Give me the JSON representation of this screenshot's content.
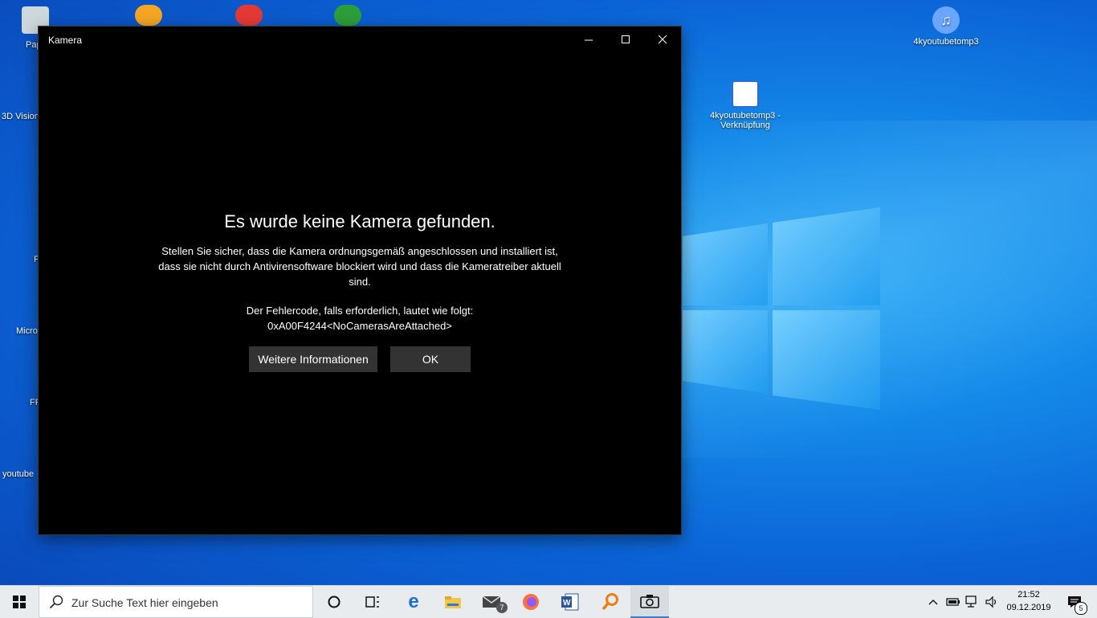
{
  "window": {
    "title": "Kamera",
    "headline": "Es wurde keine Kamera gefunden.",
    "body": "Stellen Sie sicher, dass die Kamera ordnungsgemäß angeschlossen und installiert ist, dass sie nicht durch Antivirensoftware blockiert wird und dass die Kameratreiber aktuell sind.",
    "code_line1": "Der Fehlercode, falls erforderlich, lautet wie folgt:",
    "code_line2": "0xA00F4244<NoCamerasAreAttached>",
    "more_button": "Weitere Informationen",
    "ok_button": "OK"
  },
  "desktop": {
    "left_labels": [
      "Pap",
      "3D Vision",
      "F",
      "Micro",
      "FR",
      "youtube"
    ],
    "icons": [
      {
        "label": "4kyoutubetomp3",
        "icon": "music-cloud-icon"
      },
      {
        "label": "4kyoutubetomp3 - Verknüpfung",
        "icon": "shortcut-icon"
      }
    ]
  },
  "taskbar": {
    "search_placeholder": "Zur Suche Text hier eingeben",
    "mail_badge": "7",
    "notification_badge": "5",
    "time": "21:52",
    "date": "09.12.2019"
  },
  "colors": {
    "window_bg": "#000000",
    "button_bg": "#333333",
    "taskbar_bg": "#e9ecef",
    "desktop_blue": "#0b63d6"
  }
}
